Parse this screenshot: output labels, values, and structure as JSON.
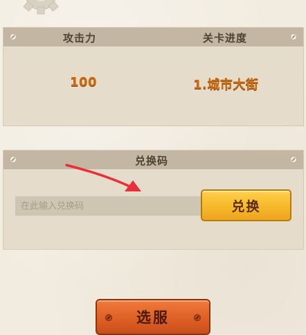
{
  "stats": {
    "attack_label": "攻击力",
    "progress_label": "关卡进度",
    "attack_value": "100",
    "progress_value": "1.城市大街"
  },
  "redeem": {
    "title": "兑换码",
    "placeholder": "在此输入兑换码",
    "button_label": "兑换"
  },
  "server": {
    "button_label": "选服"
  },
  "colors": {
    "panel_header": "#c3b7a3",
    "value_orange": "#c96a16",
    "redeem_button": "#f6b92a",
    "select_button": "#dc5e24",
    "arrow_red": "#e8303a"
  },
  "icons": [
    "gear-logo-icon",
    "rivet-icon",
    "red-arrow-icon"
  ]
}
